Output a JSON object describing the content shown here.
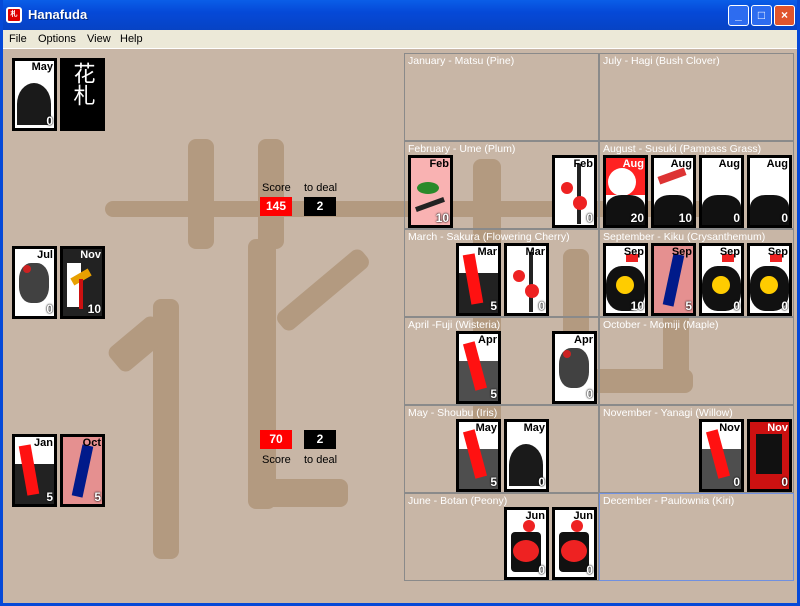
{
  "window": {
    "title": "Hanafuda",
    "icon": "hanafuda-app-icon",
    "minimize": "_",
    "maximize": "□",
    "close": "×"
  },
  "menu": [
    "File",
    "Options",
    "View",
    "Help"
  ],
  "watermark": "花札",
  "card_back": "花札",
  "colors": {
    "background": "#c8b6a6",
    "watermark": "#b39a80",
    "score": "#ff0000",
    "to_deal": "#000000"
  },
  "opponent": {
    "score_label": "Score",
    "score": "145",
    "deal_label": "to deal",
    "to_deal": "2"
  },
  "player": {
    "score_label": "Score",
    "score": "70",
    "deal_label": "to deal",
    "to_deal": "2"
  },
  "left_cards": [
    {
      "month": "May",
      "points": "0",
      "style": "iris"
    },
    {
      "month": "Jul",
      "points": "0",
      "style": "clover"
    },
    {
      "month": "Nov",
      "points": "10",
      "style": "swallow"
    },
    {
      "month": "Jan",
      "points": "5",
      "style": "red-poem"
    },
    {
      "month": "Oct",
      "points": "5",
      "style": "blue-ribbon"
    }
  ],
  "months": [
    {
      "label": "January - Matsu (Pine)",
      "cards": []
    },
    {
      "label": "February - Ume (Plum)",
      "cards": [
        {
          "month": "Feb",
          "points": "10",
          "style": "bird"
        },
        {
          "month": "Feb",
          "points": "0",
          "style": "plum"
        }
      ]
    },
    {
      "label": "March - Sakura (Flowering Cherry)",
      "cards": [
        {
          "month": "Mar",
          "points": "5",
          "style": "red-poem"
        },
        {
          "month": "Mar",
          "points": "0",
          "style": "plum"
        }
      ]
    },
    {
      "label": "April -Fuji (Wisteria)",
      "cards": [
        {
          "month": "Apr",
          "points": "5",
          "style": "red-ribbon"
        },
        {
          "month": "Apr",
          "points": "0",
          "style": "plant"
        }
      ]
    },
    {
      "label": "May - Shoubu (Iris)",
      "cards": [
        {
          "month": "May",
          "points": "5",
          "style": "red-ribbon"
        },
        {
          "month": "May",
          "points": "0",
          "style": "iris"
        }
      ]
    },
    {
      "label": "June - Botan (Peony)",
      "cards": [
        {
          "month": "Jun",
          "points": "0",
          "style": "peony"
        },
        {
          "month": "Jun",
          "points": "0",
          "style": "peony"
        }
      ]
    },
    {
      "label": "July - Hagi (Bush Clover)",
      "cards": []
    },
    {
      "label": "August - Susuki (Pampass Grass)",
      "cards": [
        {
          "month": "Aug",
          "points": "20",
          "style": "moon"
        },
        {
          "month": "Aug",
          "points": "10",
          "style": "geese"
        },
        {
          "month": "Aug",
          "points": "0",
          "style": "hill"
        },
        {
          "month": "Aug",
          "points": "0",
          "style": "hill"
        }
      ]
    },
    {
      "label": "September - Kiku (Crysanthemum)",
      "cards": [
        {
          "month": "Sep",
          "points": "10",
          "style": "chrys"
        },
        {
          "month": "Sep",
          "points": "5",
          "style": "blue-ribbon"
        },
        {
          "month": "Sep",
          "points": "0",
          "style": "chrys"
        },
        {
          "month": "Sep",
          "points": "0",
          "style": "chrys"
        }
      ]
    },
    {
      "label": "October - Momiji (Maple)",
      "cards": []
    },
    {
      "label": "November - Yanagi (Willow)",
      "cards": [
        {
          "month": "Nov",
          "points": "0",
          "style": "willow-ribbon"
        },
        {
          "month": "Nov",
          "points": "0",
          "style": "lightning"
        }
      ]
    },
    {
      "label": "December - Paulownia (Kiri)",
      "cards": []
    }
  ]
}
